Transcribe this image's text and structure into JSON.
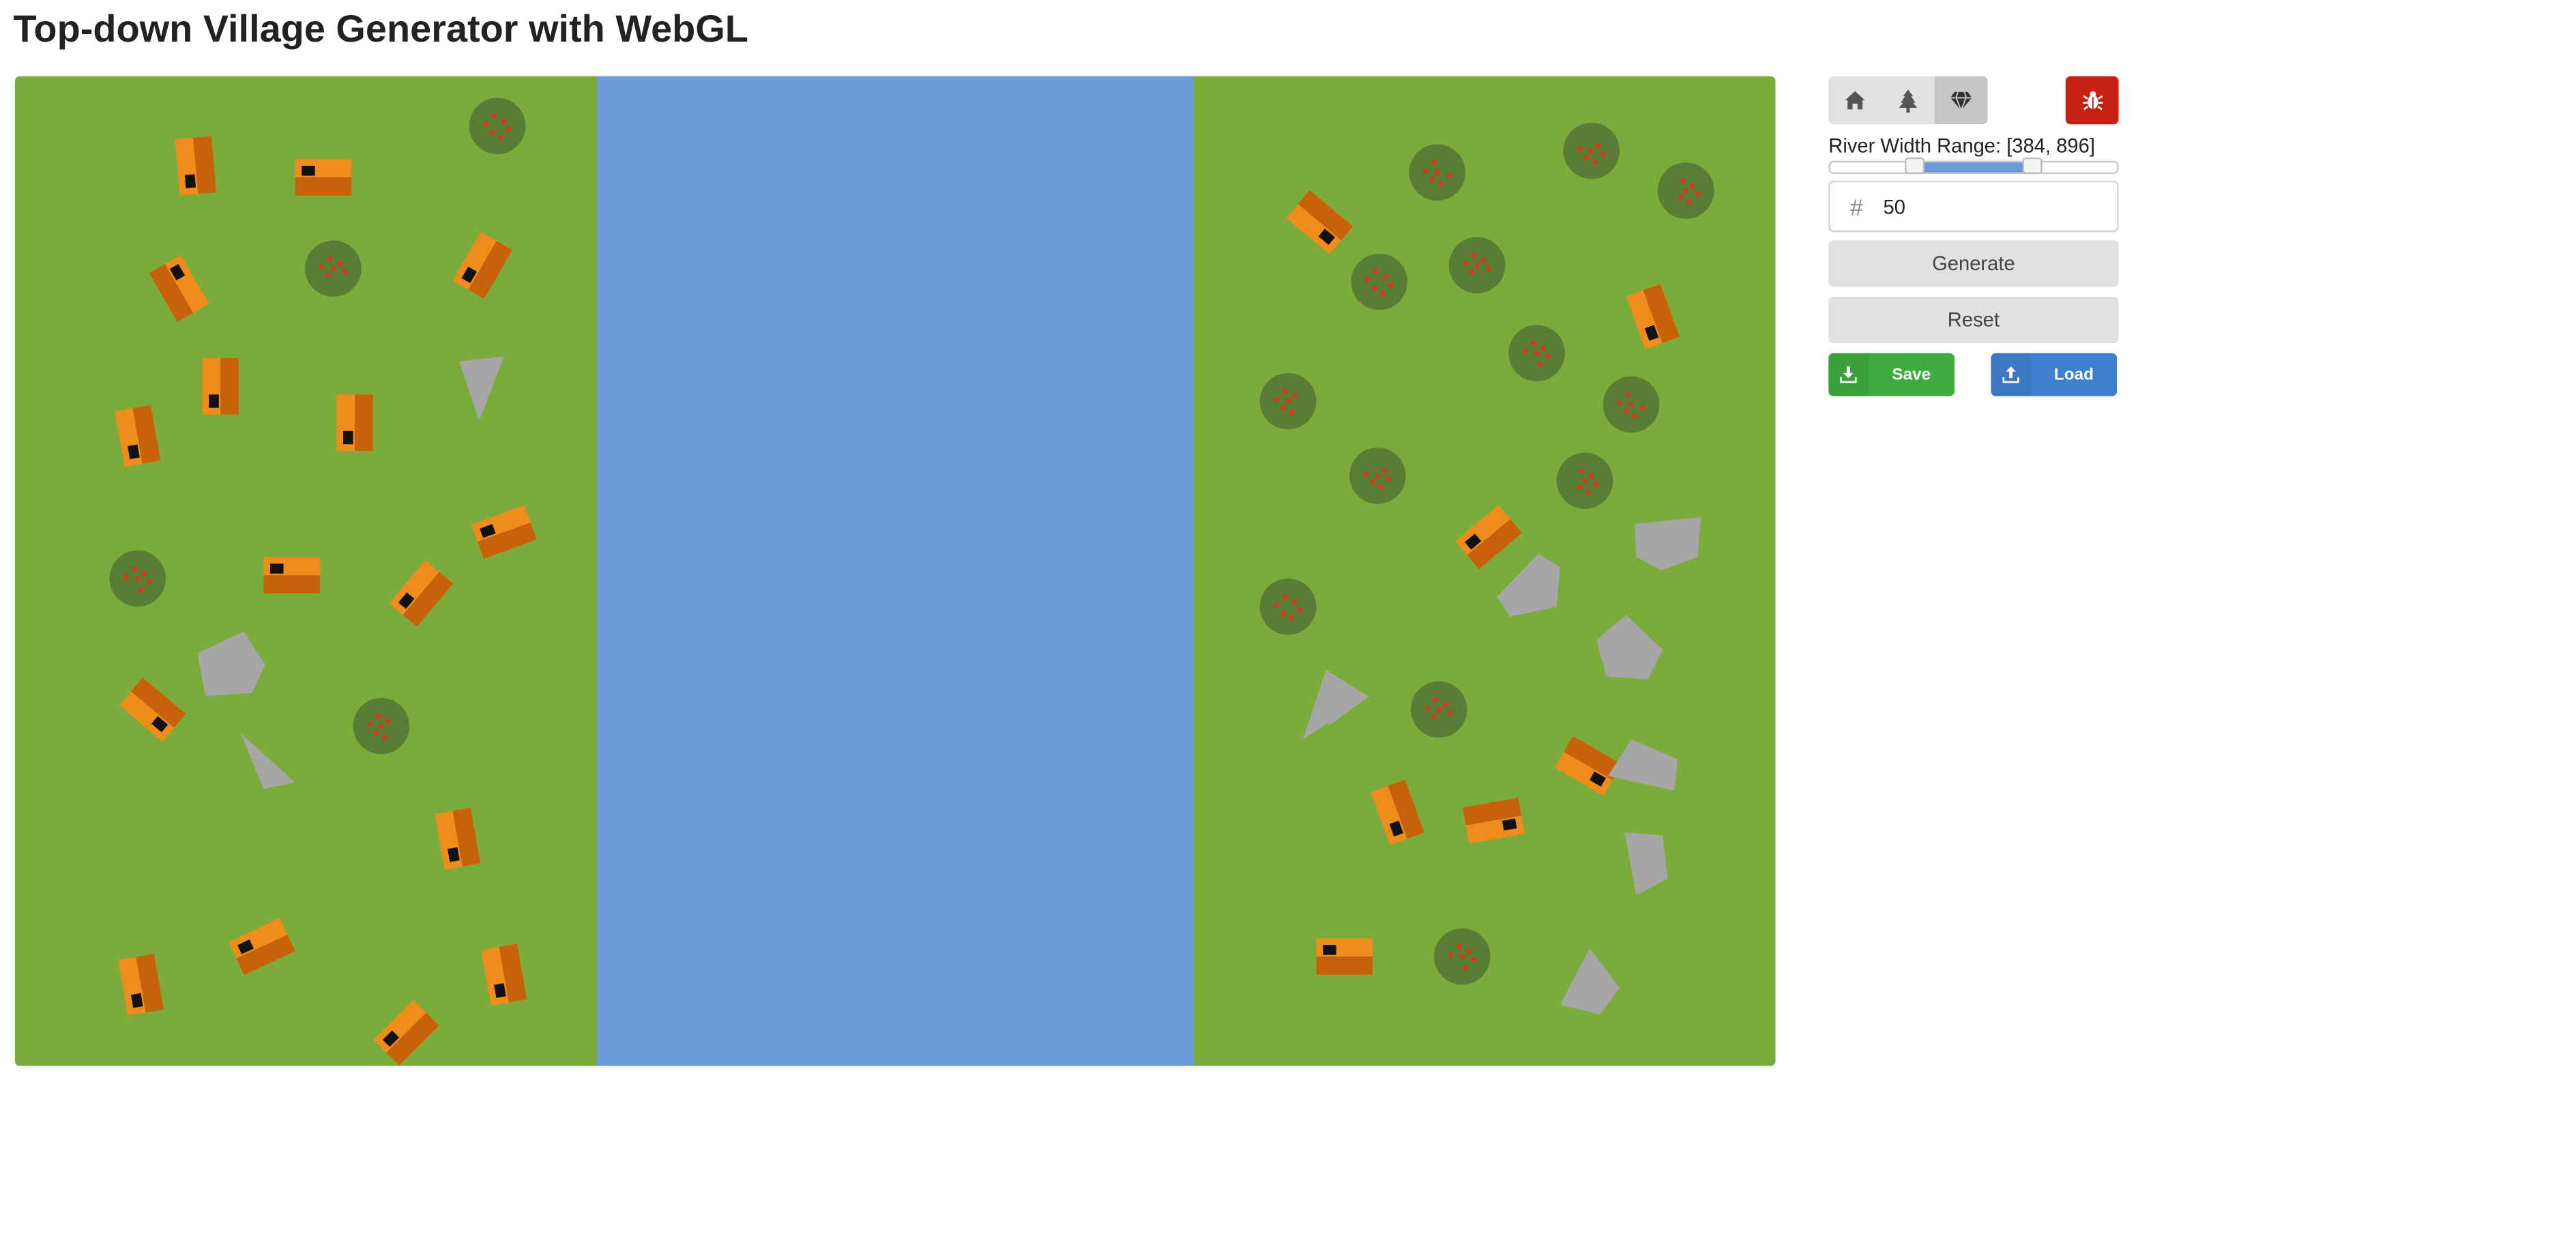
{
  "page": {
    "title": "Top-down Village Generator with WebGL"
  },
  "toolbar": {
    "modes": [
      {
        "name": "house-icon",
        "active": false
      },
      {
        "name": "tree-icon",
        "active": false
      },
      {
        "name": "gem-icon",
        "active": true
      }
    ],
    "debug_icon": "bug-icon"
  },
  "river_range": {
    "label": "River Width Range: [384, 896]",
    "min": 384,
    "max": 896
  },
  "seed": {
    "icon": "hash-icon",
    "value": "50"
  },
  "buttons": {
    "generate": "Generate",
    "reset": "Reset",
    "save": "Save",
    "load": "Load"
  },
  "colors": {
    "grass": "#7bac3b",
    "river": "#6a9ad8",
    "house_light": "#f08c1c",
    "house_dark": "#c8620a",
    "tree": "#597d34",
    "berry": "#d63a1e",
    "rock": "#a6a6a6",
    "save": "#3faa3f",
    "load": "#3f7fd0",
    "debug": "#c72116"
  }
}
